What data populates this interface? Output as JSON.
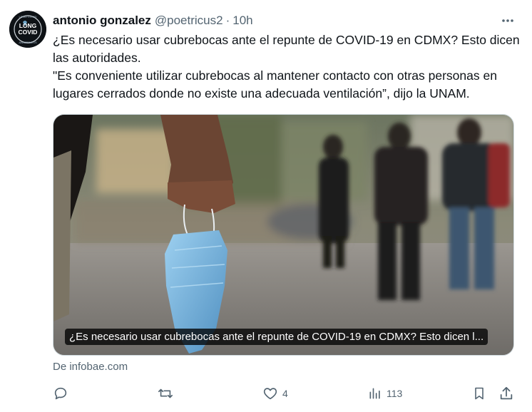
{
  "tweet": {
    "author_name": "antonio gonzalez",
    "handle": "@poetricus2",
    "separator": "·",
    "time": "10h",
    "avatar_text": {
      "line1": "LONG",
      "line2": "COVID",
      "ring_top": "LONG COVID",
      "ring_bottom": "AWARENESS"
    },
    "text_line1": "¿Es necesario usar cubrebocas ante el repunte de COVID-19 en CDMX? Esto dicen las autoridades.",
    "text_line2": "\"Es conveniente utilizar cubrebocas al mantener contacto con otras personas en lugares cerrados donde no existe una adecuada ventilación”, dijo la UNAM.",
    "card": {
      "caption": "¿Es necesario usar cubrebocas ante el repunte de COVID-19 en CDMX? Esto dicen l...",
      "source": "De infobae.com"
    },
    "actions": {
      "reply_icon": "reply-icon",
      "retweet_icon": "retweet-icon",
      "like_icon": "heart-icon",
      "like_count": "4",
      "views_icon": "views-icon",
      "views_count": "113",
      "bookmark_icon": "bookmark-icon",
      "share_icon": "share-icon"
    },
    "colors": {
      "text": "#0f1419",
      "secondary": "#536471",
      "border": "#cfd9de",
      "mask": "#6fb0dd"
    }
  }
}
